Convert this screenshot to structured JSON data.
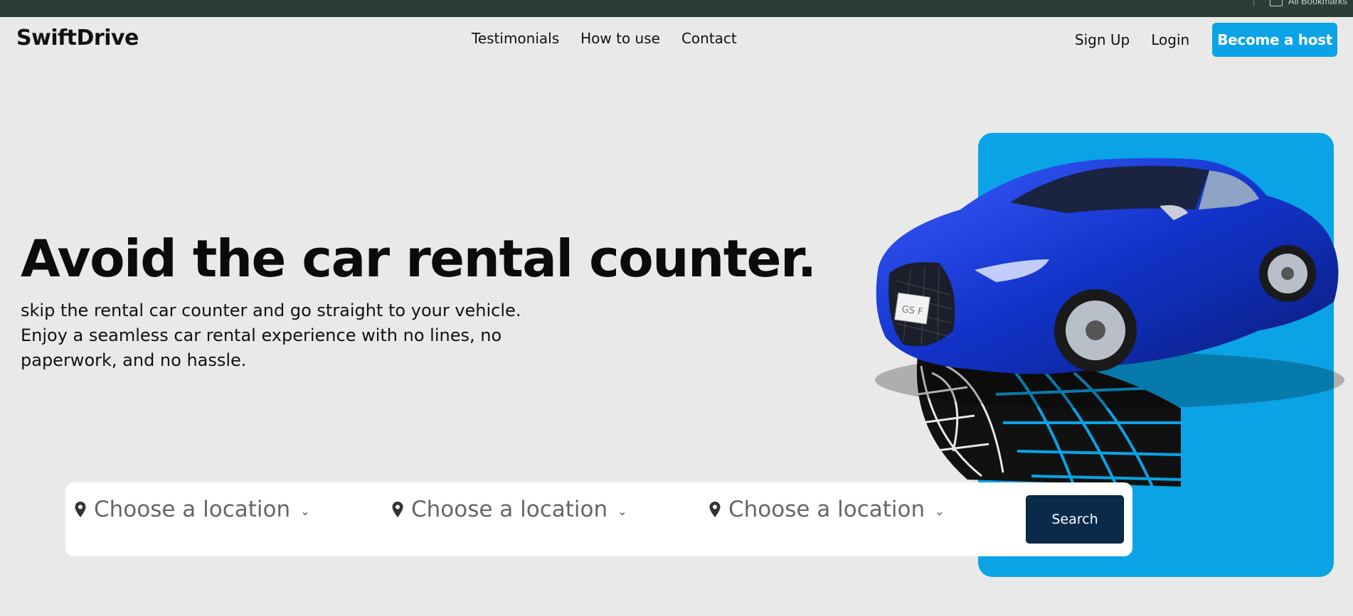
{
  "browser": {
    "bookmarks_label": "All Bookmarks"
  },
  "nav": {
    "logo": "SwiftDrive",
    "links": [
      "Testimonials",
      "How to use",
      "Contact"
    ],
    "signup": "Sign Up",
    "login": "Login",
    "host_button": "Become a host"
  },
  "hero": {
    "headline": "Avoid the car rental counter.",
    "subtext": "skip the rental car counter and go straight to your vehicle. Enjoy a seamless car rental experience with no lines, no paperwork, and no hassle.",
    "car_plate": "GS F"
  },
  "search": {
    "fields": [
      {
        "placeholder": "Choose a location",
        "icon": "location-pin-icon"
      },
      {
        "placeholder": "Choose a location",
        "icon": "location-pin-icon"
      },
      {
        "placeholder": "Choose a location",
        "icon": "location-pin-icon"
      }
    ],
    "button": "Search"
  },
  "colors": {
    "accent": "#0aa3e6",
    "search_button": "#0a2a4a",
    "background": "#e9e9e9",
    "browser_bar": "#2b3d36"
  }
}
